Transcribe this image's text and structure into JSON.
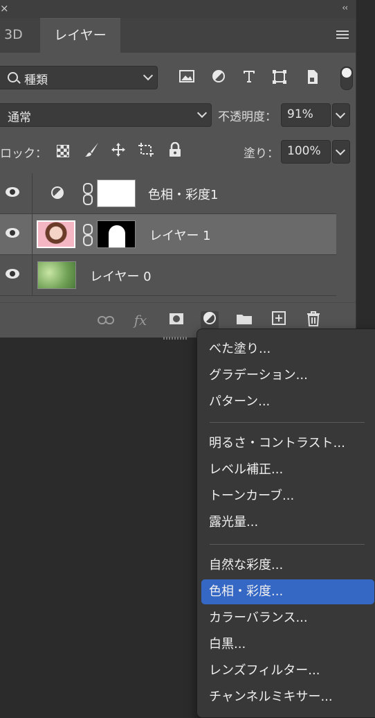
{
  "window": {
    "close_glyph": "×",
    "collapse_glyph": "‹‹"
  },
  "tabs": [
    {
      "label": "3D"
    },
    {
      "label": "レイヤー",
      "active": true
    }
  ],
  "filter": {
    "value": "種類",
    "icons": [
      "image-icon",
      "adjustment-icon",
      "type-icon",
      "shape-icon",
      "smart-object-icon"
    ]
  },
  "blend": {
    "mode": "通常",
    "opacity_label": "不透明度：",
    "opacity_value": "91%"
  },
  "lock": {
    "label": "ロック：",
    "fill_label": "塗り：",
    "fill_value": "100%"
  },
  "layers": [
    {
      "name": "色相・彩度1",
      "type": "adjustment"
    },
    {
      "name": "レイヤー 1",
      "type": "pixel",
      "selected": true
    },
    {
      "name": "レイヤー 0",
      "type": "pixel"
    }
  ],
  "bottom_icons": [
    "link-icon",
    "fx-icon",
    "mask-icon",
    "adjustment-icon",
    "folder-icon",
    "new-layer-icon",
    "trash-icon"
  ],
  "fx_label": "fx",
  "menu": {
    "group1": [
      "べた塗り...",
      "グラデーション...",
      "パターン..."
    ],
    "group2": [
      "明るさ・コントラスト...",
      "レベル補正...",
      "トーンカーブ...",
      "露光量..."
    ],
    "group3": [
      "自然な彩度...",
      "色相・彩度...",
      "カラーバランス...",
      "白黒...",
      "レンズフィルター...",
      "チャンネルミキサー..."
    ],
    "highlighted": "色相・彩度..."
  },
  "colors": {
    "panel": "#535353",
    "selected_row": "#6a6a6a",
    "menu_bg": "#383838",
    "highlight": "#3567c4"
  }
}
